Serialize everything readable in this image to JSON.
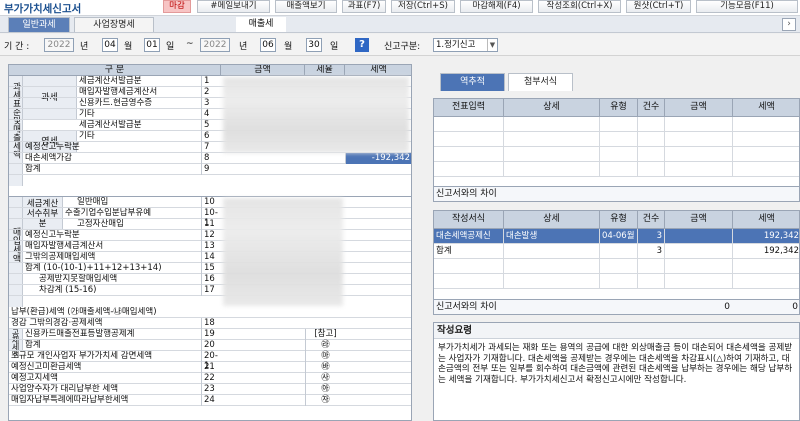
{
  "toolbar": {
    "title": "부가가치세신고서",
    "buttons": [
      "마감",
      "#메일보내기",
      "매출액보기",
      "과표(F7)",
      "저장(Ctrl+S)",
      "마감해제(F4)",
      "작성조회(Ctrl+X)",
      "원샷(Ctrl+T)",
      "기능모음(F11)"
    ]
  },
  "tabs": {
    "general": "일반과세",
    "business": "사업장명세",
    "page": "매출세"
  },
  "period": {
    "label": "기 간 :",
    "from_year": "2022",
    "year_unit": "년",
    "from_month": "04",
    "month_unit": "월",
    "from_day": "01",
    "day_unit": "일",
    "tilde": "~",
    "to_year": "2022",
    "to_month": "06",
    "to_day": "30",
    "type_label": "신고구분:",
    "type_value": "1.정기신고"
  },
  "left_table": {
    "headers": [
      "구 분",
      "금액",
      "세율",
      "세액"
    ],
    "groups": {
      "tax_base": "과세표준및매출세액",
      "taxable": "과세",
      "zero_rate": "영세",
      "purchase": "매입세액",
      "invoice_recv": "세금계산서수취부분",
      "deduction": "공제세액"
    },
    "rows": [
      {
        "label": "세금계산서발급분",
        "num": "1"
      },
      {
        "label": "매입자발행세금계산서",
        "num": "2"
      },
      {
        "label": "신용카드.현금영수증",
        "num": "3"
      },
      {
        "label": "기타",
        "num": "4"
      },
      {
        "label": "세금계산서발급분",
        "num": "5"
      },
      {
        "label": "기타",
        "num": "6"
      },
      {
        "label": "예정신고누락분",
        "num": "7"
      },
      {
        "label": "대손세액가감",
        "num": "8",
        "tax": "-192,342"
      },
      {
        "label": "합계",
        "num": "9"
      },
      {
        "label": "일반매입",
        "num": "10"
      },
      {
        "label": "수출기업수입분납부유예",
        "num": "10-1"
      },
      {
        "label": "고정자산매입",
        "num": "11"
      },
      {
        "label": "예정신고누락분",
        "num": "12"
      },
      {
        "label": "매입자발행세금계산서",
        "num": "13"
      },
      {
        "label": "그밖의공제매입세액",
        "num": "14"
      },
      {
        "label": "합계 (10-(10-1)+11+12+13+14)",
        "num": "15"
      },
      {
        "label": "공제받지못할매입세액",
        "num": "16"
      },
      {
        "label": "차감계 (15-16)",
        "num": "17"
      },
      {
        "label": "납부(환급)세액 (㉮매출세액-㉯매입세액)",
        "num": ""
      },
      {
        "label": "경감 그밖의경감·공제세액",
        "num": "18"
      },
      {
        "label": "신용카드매출전표등발행공제계",
        "num": "19",
        "rate": "[참고]"
      },
      {
        "label": "합계",
        "num": "20",
        "tax_mark": "㉱"
      },
      {
        "label": "소규모 개인사업자 부가가치세 감면세액",
        "num": "20-1",
        "tax_mark": "㉲"
      },
      {
        "label": "예정신고미환급세액",
        "num": "21",
        "tax_mark": "㉳"
      },
      {
        "label": "예정고지세액",
        "num": "22",
        "tax_mark": "㉴"
      },
      {
        "label": "사업양수자가 대리납부한 세액",
        "num": "23",
        "tax_mark": "㉵"
      },
      {
        "label": "매입자납부특례에따라납부한세액",
        "num": "24",
        "tax_mark": "㉶"
      }
    ]
  },
  "right_tabs": {
    "ledger": "역추적",
    "attach": "첨부서식"
  },
  "entry_table": {
    "headers": [
      "전표입력",
      "상세",
      "유형",
      "건수",
      "금액",
      "세액"
    ],
    "diff_label": "신고서와의 차이"
  },
  "form_table": {
    "headers": [
      "작성서식",
      "상세",
      "유형",
      "건수",
      "금액",
      "세액"
    ],
    "rows": [
      {
        "form": "대손세액공제신",
        "detail": "대손발생",
        "type": "04-06월",
        "count": "3",
        "amount": "",
        "tax": "192,342"
      },
      {
        "form": "합계",
        "detail": "",
        "type": "",
        "count": "3",
        "amount": "",
        "tax": "192,342"
      }
    ],
    "diff_label": "신고서와의 차이",
    "diff_amount": "0",
    "diff_tax": "0"
  },
  "note": {
    "title": "작성요령",
    "body": "부가가치세가 과세되는 재화 또는 용역의 공급에 대한 외상매출금 등이 대손되어 대손세액을 공제받는 사업자가 기재합니다. 대손세액을 공제받는 경우에는 대손세액을 차감표시(△)하여 기재하고, 대손금액의 전부 또는 일부를 회수하여 대손금액에 관련된 대손세액을 납부하는 경우에는 해당 납부하는 세액을 기재합니다. 부가가치세신고서 확정신고시에만 작성합니다."
  },
  "colors": {
    "accent": "#4c74b5",
    "header": "#c9d3e0",
    "negative": "#4c74b5"
  }
}
